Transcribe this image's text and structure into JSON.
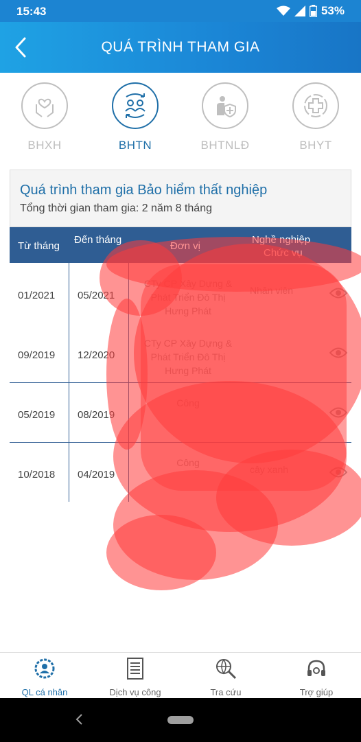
{
  "status_bar": {
    "time": "15:43",
    "battery": "53%"
  },
  "app_bar": {
    "title": "QUÁ TRÌNH THAM GIA"
  },
  "tabs": [
    {
      "label": "BHXH",
      "icon": "hands-heart-icon",
      "active": false
    },
    {
      "label": "BHTN",
      "icon": "people-exchange-icon",
      "active": true
    },
    {
      "label": "BHTNLĐ",
      "icon": "worker-shield-icon",
      "active": false
    },
    {
      "label": "BHYT",
      "icon": "medical-cross-icon",
      "active": false
    }
  ],
  "info": {
    "heading": "Quá trình tham gia Bảo hiểm thất nghiệp",
    "summary": "Tổng thời gian tham gia: 2 năm 8 tháng"
  },
  "table": {
    "headers": {
      "from": "Từ tháng",
      "to": "Đến tháng",
      "unit": "Đơn vị",
      "occupation": "Nghề nghiệp",
      "position": "Chức vụ"
    },
    "rows": [
      {
        "from": "01/2021",
        "to": "05/2021",
        "unit": "CTy CP Xây Dựng & Phát Triển Đô Thị Hưng Phát",
        "occupation": "Nhân viên",
        "position": ""
      },
      {
        "from": "09/2019",
        "to": "12/2020",
        "unit": "CTy CP Xây Dựng & Phát Triển Đô Thị Hưng Phát",
        "occupation": "",
        "position": ""
      },
      {
        "from": "05/2019",
        "to": "08/2019",
        "unit": "Công",
        "occupation": "",
        "position": ""
      },
      {
        "from": "10/2018",
        "to": "04/2019",
        "unit": "Công",
        "occupation": "cây xanh",
        "position": ""
      }
    ]
  },
  "bottom_nav": [
    {
      "label": "QL cá nhân",
      "icon": "personal-gear-icon",
      "active": true
    },
    {
      "label": "Dịch vụ công",
      "icon": "document-icon",
      "active": false
    },
    {
      "label": "Tra cứu",
      "icon": "search-globe-icon",
      "active": false
    },
    {
      "label": "Trợ giúp",
      "icon": "headset-icon",
      "active": false
    }
  ],
  "colors": {
    "app_bar": "#1b86d6",
    "table_header": "#2f5d93",
    "accent": "#1f6fa8",
    "redaction": "#ff3b3b"
  }
}
